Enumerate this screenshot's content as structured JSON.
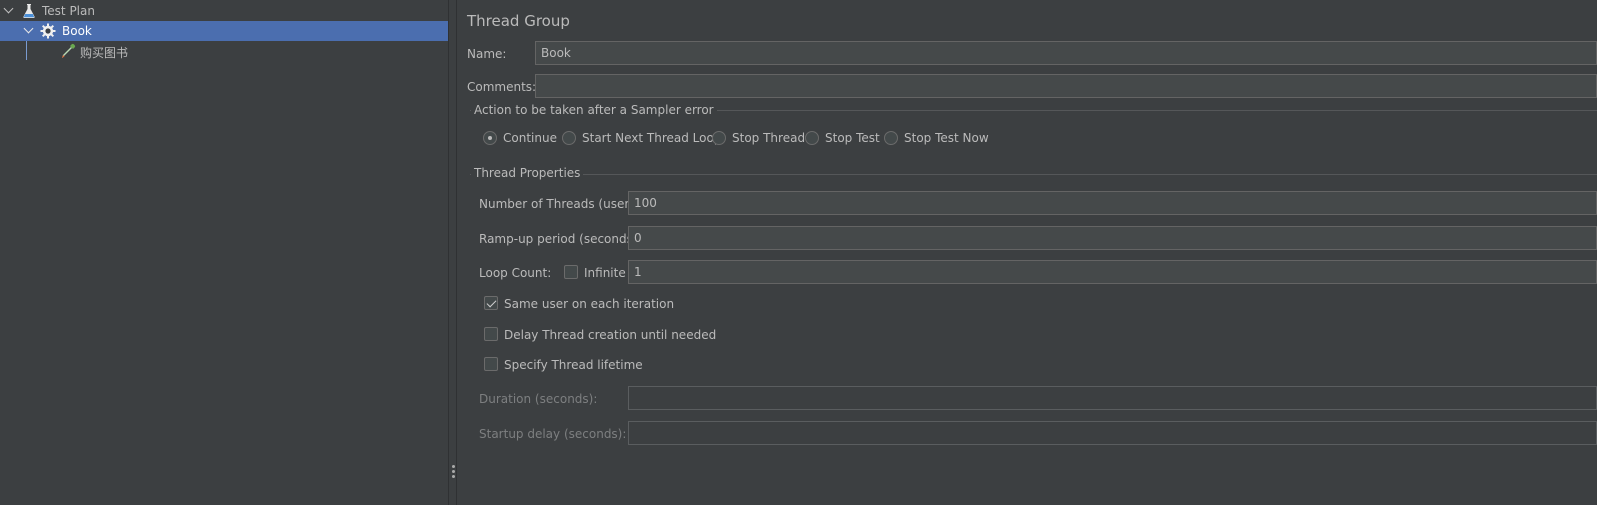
{
  "tree": {
    "items": [
      {
        "label": "Test Plan",
        "icon": "beaker-icon"
      },
      {
        "label": "Book",
        "icon": "gear-icon"
      },
      {
        "label": "购买图书",
        "icon": "pipette-icon"
      }
    ]
  },
  "panel": {
    "title": "Thread Group",
    "name_label": "Name:",
    "name_value": "Book",
    "comments_label": "Comments:",
    "comments_value": "",
    "sampler_error": {
      "title": "Action to be taken after a Sampler error",
      "options": [
        "Continue",
        "Start Next Thread Loop",
        "Stop Thread",
        "Stop Test",
        "Stop Test Now"
      ],
      "selected": "Continue"
    },
    "thread_props": {
      "title": "Thread Properties",
      "threads_label": "Number of Threads (users):",
      "threads_value": "100",
      "rampup_label": "Ramp-up period (seconds):",
      "rampup_value": "0",
      "loop_label": "Loop Count:",
      "infinite_label": "Infinite",
      "infinite_checked": false,
      "loop_value": "1",
      "same_user_label": "Same user on each iteration",
      "same_user_checked": true,
      "delay_label": "Delay Thread creation until needed",
      "delay_checked": false,
      "lifetime_label": "Specify Thread lifetime",
      "lifetime_checked": false,
      "duration_label": "Duration (seconds):",
      "duration_value": "",
      "startup_label": "Startup delay (seconds):",
      "startup_value": ""
    }
  },
  "colors": {
    "background": "#3c3f41",
    "selection": "#4b6eaf",
    "text": "#bbbbbb",
    "field_bg": "#45494a"
  }
}
